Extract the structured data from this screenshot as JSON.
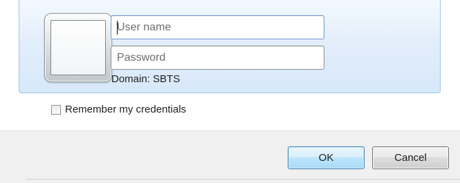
{
  "credential": {
    "username_placeholder": "User name",
    "password_placeholder": "Password",
    "domain_label": "Domain: SBTS"
  },
  "options": {
    "remember_label": "Remember my credentials",
    "remember_checked": false
  },
  "buttons": {
    "ok_label": "OK",
    "cancel_label": "Cancel"
  },
  "colors": {
    "tile_border": "#9cc3e6",
    "tile_background": "#dce9f9",
    "footer_background": "#f0f0f0",
    "ok_border": "#3c7fb1"
  }
}
